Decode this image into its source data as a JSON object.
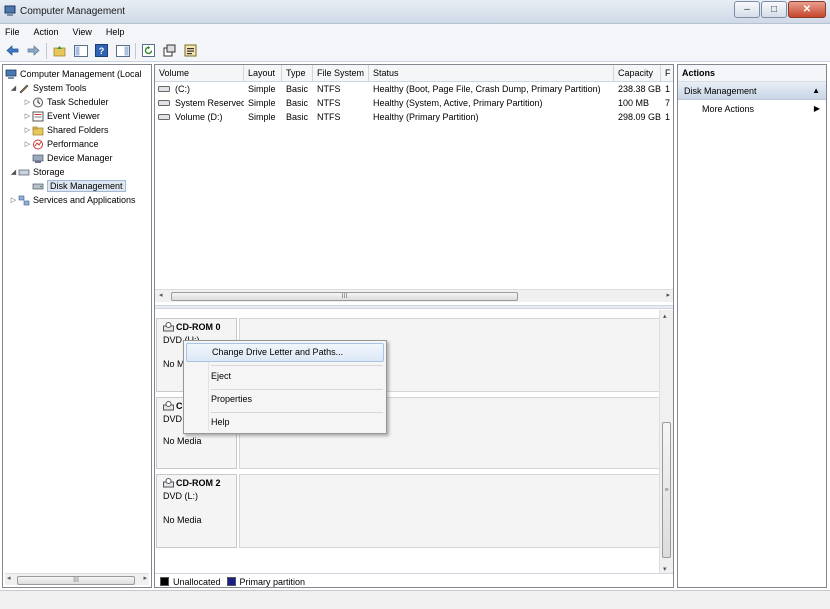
{
  "window": {
    "title": "Computer Management",
    "minimize": "–",
    "maximize": "□",
    "close": "✕"
  },
  "menubar": [
    "File",
    "Action",
    "View",
    "Help"
  ],
  "toolbar": {
    "icons": [
      "back-icon",
      "forward-icon",
      "up-icon",
      "show-hide-tree-icon",
      "help-icon",
      "show-hide-action-pane-icon",
      "refresh-icon",
      "properties-icon",
      "export-icon"
    ]
  },
  "tree": {
    "root": "Computer Management (Local",
    "items": [
      {
        "label": "System Tools",
        "level": 1,
        "expander": "◢"
      },
      {
        "label": "Task Scheduler",
        "level": 2,
        "expander": "▷"
      },
      {
        "label": "Event Viewer",
        "level": 2,
        "expander": "▷"
      },
      {
        "label": "Shared Folders",
        "level": 2,
        "expander": "▷"
      },
      {
        "label": "Performance",
        "level": 2,
        "expander": "▷"
      },
      {
        "label": "Device Manager",
        "level": 2,
        "expander": ""
      },
      {
        "label": "Storage",
        "level": 1,
        "expander": "◢"
      },
      {
        "label": "Disk Management",
        "level": 2,
        "expander": "",
        "selected": true
      },
      {
        "label": "Services and Applications",
        "level": 1,
        "expander": "▷"
      }
    ],
    "scroll_label": "III"
  },
  "volumes": {
    "columns": [
      "Volume",
      "Layout",
      "Type",
      "File System",
      "Status",
      "Capacity",
      "F"
    ],
    "rows": [
      [
        "(C:)",
        "Simple",
        "Basic",
        "NTFS",
        "Healthy (Boot, Page File, Crash Dump, Primary Partition)",
        "238.38 GB",
        "1"
      ],
      [
        "System Reserved",
        "Simple",
        "Basic",
        "NTFS",
        "Healthy (System, Active, Primary Partition)",
        "100 MB",
        "7"
      ],
      [
        "Volume (D:)",
        "Simple",
        "Basic",
        "NTFS",
        "Healthy (Primary Partition)",
        "298.09 GB",
        "1"
      ]
    ],
    "scroll_label": "III"
  },
  "disks": [
    {
      "name": "CD-ROM 0",
      "type": "DVD (U:)",
      "media": "No Media"
    },
    {
      "name": "CD-ROM 1",
      "type": "DVD",
      "media": "No Media"
    },
    {
      "name": "CD-ROM 2",
      "type": "DVD (L:)",
      "media": "No Media"
    }
  ],
  "disk_labels_visible": {
    "d0_name": "CD-ROM 0",
    "d0_type": "DVD (U:)",
    "d0_media": "No M",
    "d1_name": "C",
    "d1_type": "DVD",
    "d1_media": "No Media",
    "d2_name": "CD-ROM 2",
    "d2_type": "DVD (L:)",
    "d2_media": "No Media"
  },
  "legend": [
    {
      "label": "Unallocated",
      "color": "#000000"
    },
    {
      "label": "Primary partition",
      "color": "#1a1f8c"
    }
  ],
  "actions": {
    "header": "Actions",
    "section": "Disk Management",
    "items": [
      "More Actions"
    ]
  },
  "context_menu": {
    "items": [
      "Change Drive Letter and Paths...",
      "Eject",
      "Properties",
      "Help"
    ]
  },
  "colors": {
    "accent": "#dce8f6",
    "selection": "#dde6f1",
    "titlebar": "#cfd9e6"
  }
}
